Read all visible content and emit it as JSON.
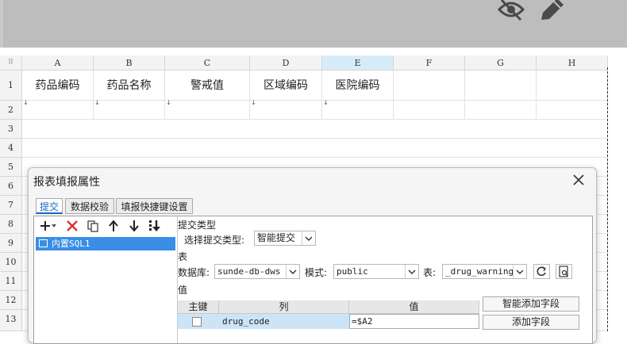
{
  "columns": [
    "A",
    "B",
    "C",
    "D",
    "E",
    "F",
    "G",
    "H"
  ],
  "rows": [
    "1",
    "2",
    "3",
    "4",
    "5",
    "6",
    "7",
    "8",
    "9",
    "10",
    "11",
    "12",
    "13"
  ],
  "row1_headers": [
    "药品编码",
    "药品名称",
    "警戒值",
    "区域编码",
    "医院编码"
  ],
  "dialog": {
    "title": "报表填报属性",
    "tabs": [
      "提交",
      "数据校验",
      "填报快捷键设置"
    ],
    "list_item": "内置SQL1",
    "submit_type_section": "提交类型",
    "choose_submit_type_label": "选择提交类型:",
    "submit_type_value": "智能提交",
    "table_section": "表",
    "database_label": "数据库:",
    "database_value": "sunde-db-dws",
    "schema_label": "模式:",
    "schema_value": "public",
    "table_label": "表:",
    "table_value": "_drug_warning",
    "value_section": "值",
    "grid_headers": [
      "主键",
      "列",
      "值"
    ],
    "grid_row": {
      "column": "drug_code",
      "value": "=$A2"
    },
    "smart_add_field": "智能添加字段",
    "add_field": "添加字段"
  }
}
